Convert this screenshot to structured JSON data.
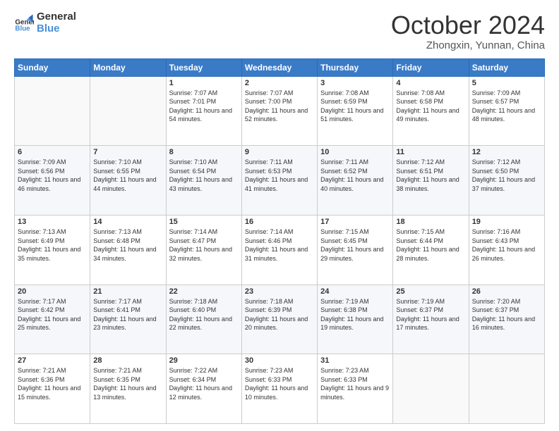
{
  "logo": {
    "line1": "General",
    "line2": "Blue"
  },
  "title": "October 2024",
  "location": "Zhongxin, Yunnan, China",
  "days_of_week": [
    "Sunday",
    "Monday",
    "Tuesday",
    "Wednesday",
    "Thursday",
    "Friday",
    "Saturday"
  ],
  "weeks": [
    [
      {
        "day": "",
        "content": ""
      },
      {
        "day": "",
        "content": ""
      },
      {
        "day": "1",
        "content": "Sunrise: 7:07 AM\nSunset: 7:01 PM\nDaylight: 11 hours and 54 minutes."
      },
      {
        "day": "2",
        "content": "Sunrise: 7:07 AM\nSunset: 7:00 PM\nDaylight: 11 hours and 52 minutes."
      },
      {
        "day": "3",
        "content": "Sunrise: 7:08 AM\nSunset: 6:59 PM\nDaylight: 11 hours and 51 minutes."
      },
      {
        "day": "4",
        "content": "Sunrise: 7:08 AM\nSunset: 6:58 PM\nDaylight: 11 hours and 49 minutes."
      },
      {
        "day": "5",
        "content": "Sunrise: 7:09 AM\nSunset: 6:57 PM\nDaylight: 11 hours and 48 minutes."
      }
    ],
    [
      {
        "day": "6",
        "content": "Sunrise: 7:09 AM\nSunset: 6:56 PM\nDaylight: 11 hours and 46 minutes."
      },
      {
        "day": "7",
        "content": "Sunrise: 7:10 AM\nSunset: 6:55 PM\nDaylight: 11 hours and 44 minutes."
      },
      {
        "day": "8",
        "content": "Sunrise: 7:10 AM\nSunset: 6:54 PM\nDaylight: 11 hours and 43 minutes."
      },
      {
        "day": "9",
        "content": "Sunrise: 7:11 AM\nSunset: 6:53 PM\nDaylight: 11 hours and 41 minutes."
      },
      {
        "day": "10",
        "content": "Sunrise: 7:11 AM\nSunset: 6:52 PM\nDaylight: 11 hours and 40 minutes."
      },
      {
        "day": "11",
        "content": "Sunrise: 7:12 AM\nSunset: 6:51 PM\nDaylight: 11 hours and 38 minutes."
      },
      {
        "day": "12",
        "content": "Sunrise: 7:12 AM\nSunset: 6:50 PM\nDaylight: 11 hours and 37 minutes."
      }
    ],
    [
      {
        "day": "13",
        "content": "Sunrise: 7:13 AM\nSunset: 6:49 PM\nDaylight: 11 hours and 35 minutes."
      },
      {
        "day": "14",
        "content": "Sunrise: 7:13 AM\nSunset: 6:48 PM\nDaylight: 11 hours and 34 minutes."
      },
      {
        "day": "15",
        "content": "Sunrise: 7:14 AM\nSunset: 6:47 PM\nDaylight: 11 hours and 32 minutes."
      },
      {
        "day": "16",
        "content": "Sunrise: 7:14 AM\nSunset: 6:46 PM\nDaylight: 11 hours and 31 minutes."
      },
      {
        "day": "17",
        "content": "Sunrise: 7:15 AM\nSunset: 6:45 PM\nDaylight: 11 hours and 29 minutes."
      },
      {
        "day": "18",
        "content": "Sunrise: 7:15 AM\nSunset: 6:44 PM\nDaylight: 11 hours and 28 minutes."
      },
      {
        "day": "19",
        "content": "Sunrise: 7:16 AM\nSunset: 6:43 PM\nDaylight: 11 hours and 26 minutes."
      }
    ],
    [
      {
        "day": "20",
        "content": "Sunrise: 7:17 AM\nSunset: 6:42 PM\nDaylight: 11 hours and 25 minutes."
      },
      {
        "day": "21",
        "content": "Sunrise: 7:17 AM\nSunset: 6:41 PM\nDaylight: 11 hours and 23 minutes."
      },
      {
        "day": "22",
        "content": "Sunrise: 7:18 AM\nSunset: 6:40 PM\nDaylight: 11 hours and 22 minutes."
      },
      {
        "day": "23",
        "content": "Sunrise: 7:18 AM\nSunset: 6:39 PM\nDaylight: 11 hours and 20 minutes."
      },
      {
        "day": "24",
        "content": "Sunrise: 7:19 AM\nSunset: 6:38 PM\nDaylight: 11 hours and 19 minutes."
      },
      {
        "day": "25",
        "content": "Sunrise: 7:19 AM\nSunset: 6:37 PM\nDaylight: 11 hours and 17 minutes."
      },
      {
        "day": "26",
        "content": "Sunrise: 7:20 AM\nSunset: 6:37 PM\nDaylight: 11 hours and 16 minutes."
      }
    ],
    [
      {
        "day": "27",
        "content": "Sunrise: 7:21 AM\nSunset: 6:36 PM\nDaylight: 11 hours and 15 minutes."
      },
      {
        "day": "28",
        "content": "Sunrise: 7:21 AM\nSunset: 6:35 PM\nDaylight: 11 hours and 13 minutes."
      },
      {
        "day": "29",
        "content": "Sunrise: 7:22 AM\nSunset: 6:34 PM\nDaylight: 11 hours and 12 minutes."
      },
      {
        "day": "30",
        "content": "Sunrise: 7:23 AM\nSunset: 6:33 PM\nDaylight: 11 hours and 10 minutes."
      },
      {
        "day": "31",
        "content": "Sunrise: 7:23 AM\nSunset: 6:33 PM\nDaylight: 11 hours and 9 minutes."
      },
      {
        "day": "",
        "content": ""
      },
      {
        "day": "",
        "content": ""
      }
    ]
  ]
}
